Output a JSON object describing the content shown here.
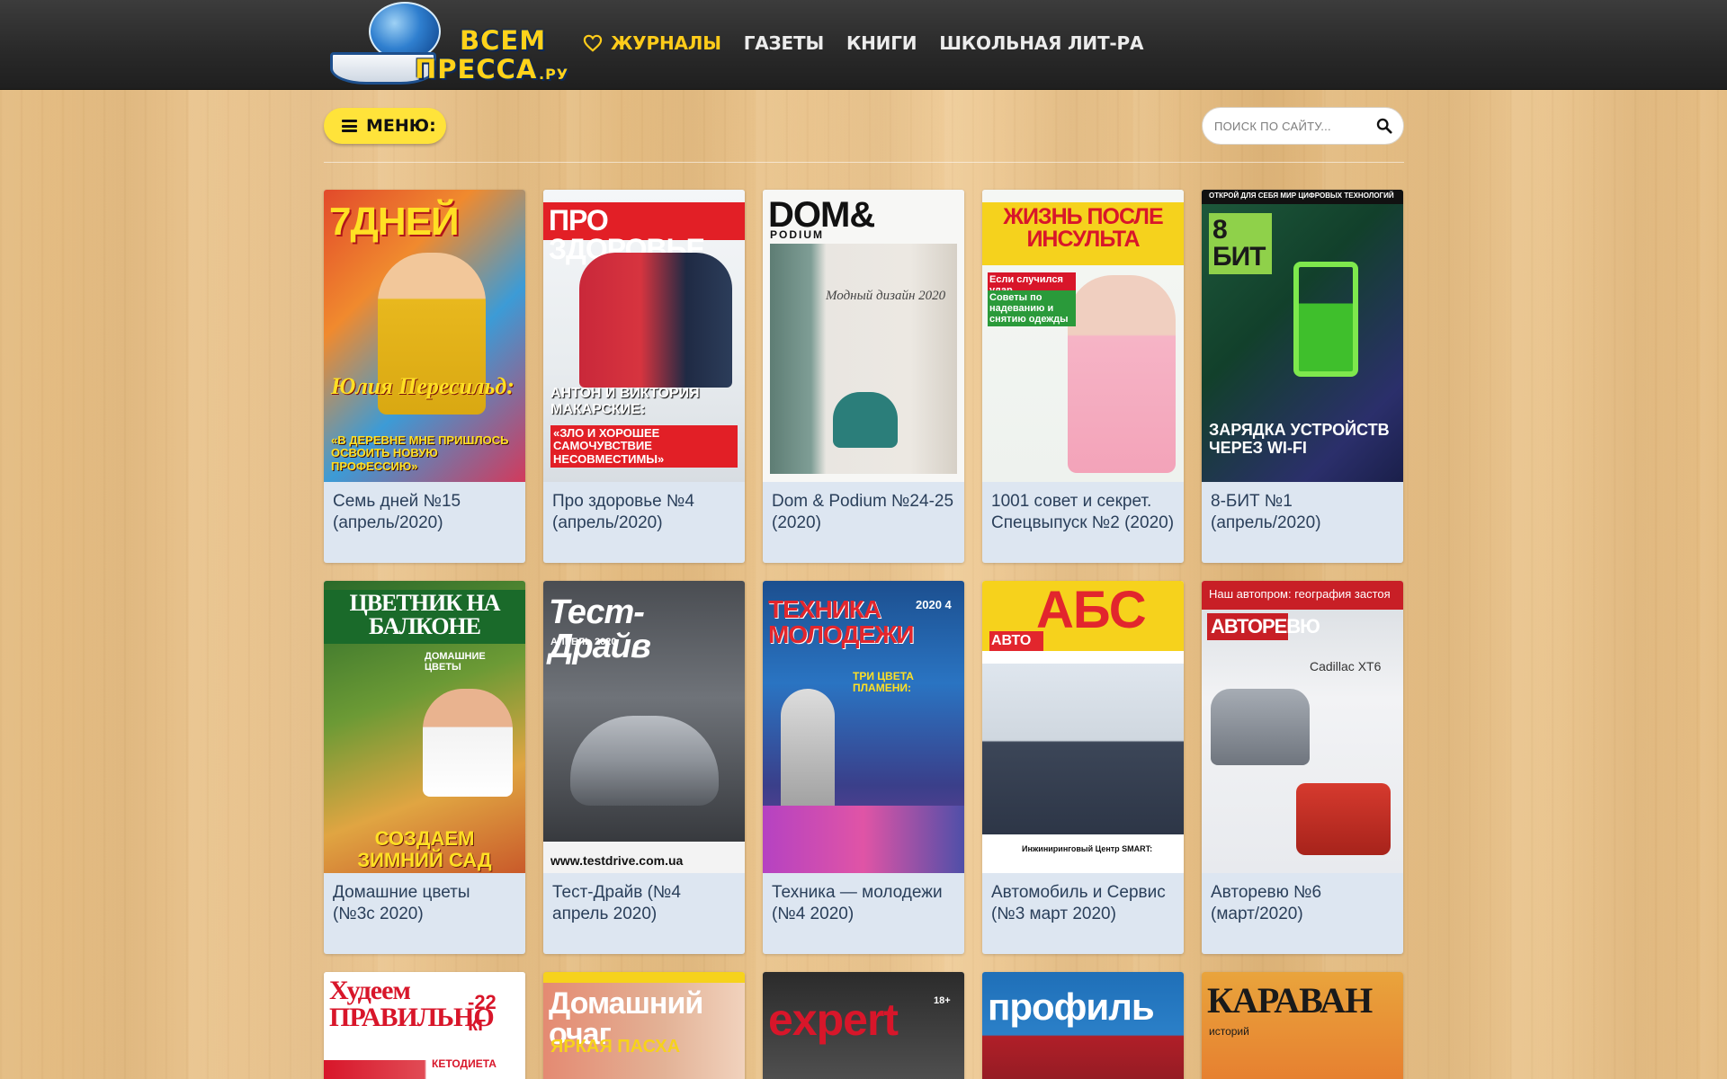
{
  "logo": {
    "line1": "ВСЕМ",
    "line2": "ПРЕССА",
    "line3": ".РУ"
  },
  "nav": [
    {
      "label": "ЖУРНАЛЫ",
      "active": true,
      "icon": "heart-icon"
    },
    {
      "label": "ГАЗЕТЫ"
    },
    {
      "label": "КНИГИ"
    },
    {
      "label": "ШКОЛЬНАЯ ЛИТ-РА"
    }
  ],
  "menu_button": {
    "label": "МЕНЮ:",
    "icon": "hamburger-icon"
  },
  "search": {
    "placeholder": "ПОИСК ПО САЙТУ...",
    "icon": "search-icon"
  },
  "colors": {
    "accent": "#ffe33a",
    "nav_active": "#ffcc1a",
    "header_bg": "#2a2a2a",
    "card_bg": "#dde6f1",
    "caption_text": "#2a3f5a"
  },
  "magazines": [
    {
      "caption": "Семь дней №15 (апрель/2020)",
      "cover_title": "7ДНЕЙ",
      "cover_headline": "Юлия Пересильд:",
      "cover_sub": "«В ДЕРЕВНЕ МНЕ ПРИШЛОСЬ ОСВОИТЬ НОВУЮ ПРОФЕССИЮ»"
    },
    {
      "caption": "Про здоровье №4 (апрель/2020)",
      "cover_title": "ПРО ЗДОРОВЬЕ",
      "cover_headline": "АНТОН И ВИКТОРИЯ МАКАРСКИЕ:",
      "cover_sub": "«ЗЛО И ХОРОШЕЕ САМОЧУВСТВИЕ НЕСОВМЕСТИМЫ»"
    },
    {
      "caption": "Dom & Podium №24-25 (2020)",
      "cover_title": "DOM&",
      "cover_headline": "PODIUM",
      "cover_sub": "Модный дизайн 2020"
    },
    {
      "caption": "1001 совет и секрет. Спецвыпуск №2 (2020)",
      "cover_title": "ЖИЗНЬ ПОСЛЕ ИНСУЛЬТА",
      "cover_headline": "Если случился удар",
      "cover_sub": "Советы по надеванию и снятию одежды"
    },
    {
      "caption": "8-БИТ №1 (апрель/2020)",
      "cover_title": "8 БИТ",
      "cover_headline": "ЗАРЯДКА УСТРОЙСТВ ЧЕРЕЗ WI-FI",
      "cover_sub": "ОТКРОЙ ДЛЯ СЕБЯ МИР ЦИФРОВЫХ ТЕХНОЛОГИЙ"
    },
    {
      "caption": "Домашние цветы (№3с 2020)",
      "cover_title": "ЦВЕТНИК НА БАЛКОНЕ",
      "cover_headline": "СОЗДАЕМ ЗИМНИЙ САД",
      "cover_sub": "ДОМАШНИЕ ЦВЕТЫ"
    },
    {
      "caption": "Тест-Драйв (№4 апрель 2020)",
      "cover_title": "Тест-Драйв",
      "cover_headline": "АПРЕЛЬ 2020",
      "cover_sub": "www.testdrive.com.ua"
    },
    {
      "caption": "Техника — молодежи (№4 2020)",
      "cover_title": "ТЕХНИКА МОЛОДЕЖИ",
      "cover_headline": "ТРИ ЦВЕТА ПЛАМЕНИ:",
      "cover_sub": "2020 4"
    },
    {
      "caption": "Автомобиль и Сервис (№3 март 2020)",
      "cover_title": "АБС",
      "cover_headline": "АВТО",
      "cover_sub": "Инжиниринговый Центр SMART:"
    },
    {
      "caption": "Авторевю №6 (март/2020)",
      "cover_title": "АВТОРЕВЮ",
      "cover_headline": "Наш автопром: география застоя",
      "cover_sub": "Cadillac XT6"
    },
    {
      "caption": "",
      "cover_title": "Худеем ПРАВИЛЬНО",
      "cover_headline": "-22 кг",
      "cover_sub": "КЕТОДИЕТА"
    },
    {
      "caption": "",
      "cover_title": "Домашний очаг",
      "cover_headline": "ЯРКАЯ ПАСХА",
      "cover_sub": ""
    },
    {
      "caption": "",
      "cover_title": "expert",
      "cover_headline": "18+",
      "cover_sub": ""
    },
    {
      "caption": "",
      "cover_title": "профиль",
      "cover_headline": "",
      "cover_sub": ""
    },
    {
      "caption": "",
      "cover_title": "КАРАВАН",
      "cover_headline": "историй",
      "cover_sub": ""
    }
  ]
}
